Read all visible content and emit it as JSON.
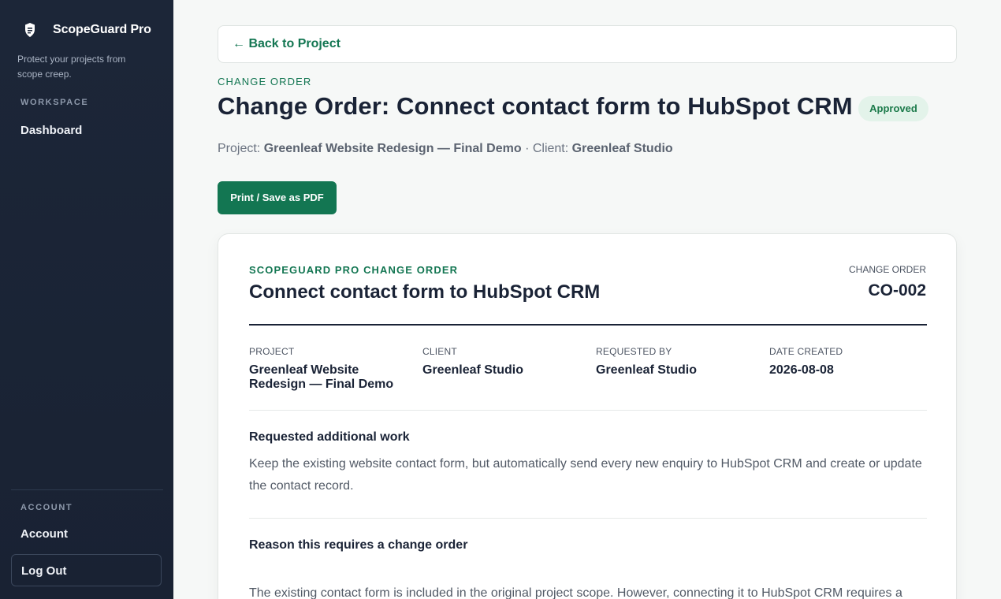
{
  "sidebar": {
    "brand": "ScopeGuard Pro",
    "tagline": "Protect your projects from scope creep.",
    "workspace_label": "WORKSPACE",
    "dashboard": "Dashboard",
    "account_label": "ACCOUNT",
    "account": "Account",
    "logout": "Log Out"
  },
  "header": {
    "back": "← Back to Project",
    "eyebrow": "CHANGE ORDER",
    "title": "Change Order: Connect contact form to HubSpot CRM",
    "status": "Approved",
    "project_prefix": "Project:",
    "project_name": "Greenleaf Website Redesign — Final Demo",
    "separator": "·",
    "client_prefix": "Client:",
    "client_name": "Greenleaf Studio",
    "print_button": "Print / Save as PDF"
  },
  "document": {
    "eyebrow": "SCOPEGUARD PRO CHANGE ORDER",
    "title": "Connect contact form to HubSpot CRM",
    "co_label": "CHANGE ORDER",
    "co_number": "CO-002",
    "fields": [
      {
        "label": "PROJECT",
        "value": "Greenleaf Website Redesign — Final Demo"
      },
      {
        "label": "CLIENT",
        "value": "Greenleaf Studio"
      },
      {
        "label": "REQUESTED BY",
        "value": "Greenleaf Studio"
      },
      {
        "label": "DATE CREATED",
        "value": "2026-08-08"
      }
    ],
    "sections": [
      {
        "heading": "Requested additional work",
        "body": "Keep the existing website contact form, but automatically send every new enquiry to HubSpot CRM and create or update the contact record."
      },
      {
        "heading": "Reason this requires a change order",
        "body": "The existing contact form is included in the original project scope. However, connecting it to HubSpot CRM requires a"
      }
    ]
  },
  "colors": {
    "accent": "#137652",
    "sidebar_bg": "#1c2638",
    "badge_bg": "#e3f3ea"
  }
}
